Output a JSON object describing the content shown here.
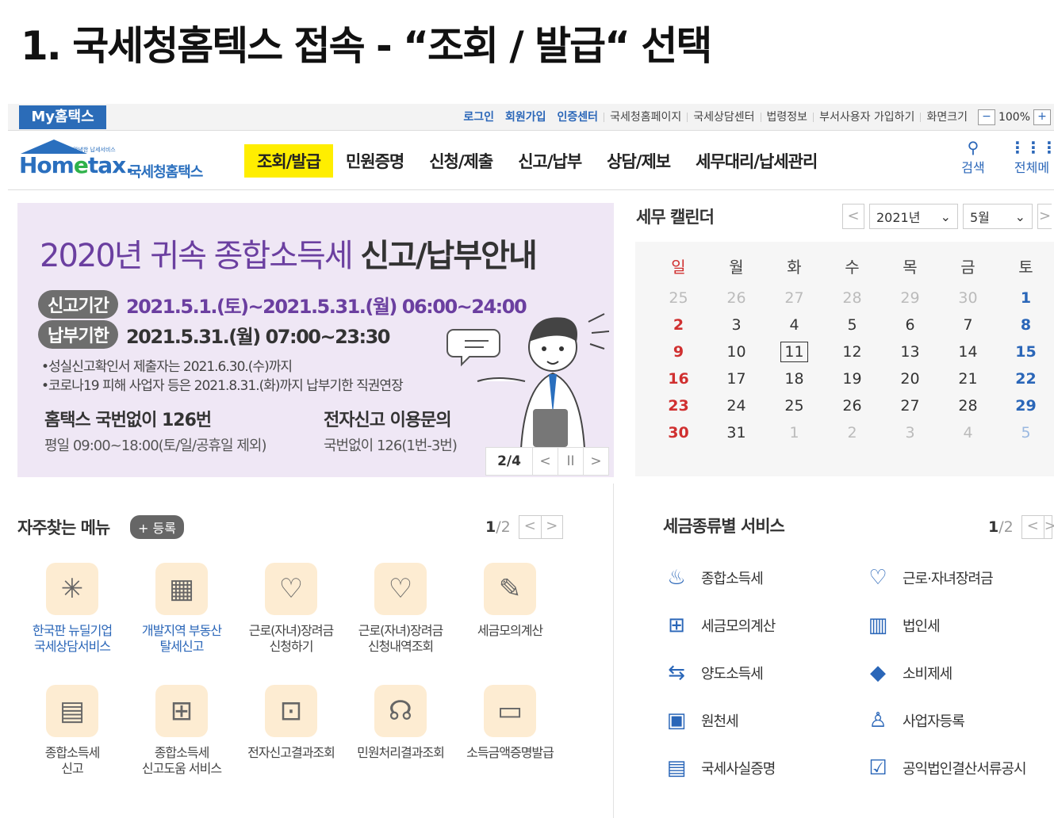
{
  "slide_title": "1. 국세청홈텍스 접속 - “조회 / 발급“ 선택",
  "util": {
    "my_hometax": "My홈택스",
    "primary_links": [
      "로그인",
      "회원가입",
      "인증센터"
    ],
    "links": [
      "국세청홈페이지",
      "국세상담센터",
      "법령정보",
      "부서사용자 가입하기",
      "화면크기"
    ],
    "zoom_minus": "−",
    "zoom_value": "100%",
    "zoom_plus": "+"
  },
  "logo": {
    "sub": "안녕한 납세서비스",
    "main_a": "Hom",
    "main_b": "e",
    "main_c": "tax.",
    "kr": "국세청홈택스"
  },
  "menu": [
    "조회/발급",
    "민원증명",
    "신청/제출",
    "신고/납부",
    "상담/제보",
    "세무대리/납세관리"
  ],
  "nav_right": {
    "search_label": "검색",
    "all_label": "전체메"
  },
  "banner": {
    "title_a": "2020년 귀속 종합소득세 ",
    "title_b": "신고/납부안내",
    "pill1": "신고기간",
    "date1": "2021.5.1.(토)~2021.5.31.(월) 06:00~24:00",
    "pill2": "납부기한",
    "date2": "2021.5.31.(월) 07:00~23:30",
    "note1": "•성실신고확인서 제출자는 2021.6.30.(수)까지",
    "note2": "•코로나19 피해 사업자 등은 2021.8.31.(화)까지 납부기한 직권연장",
    "contact1_h": "홈택스 국번없이 126번",
    "contact1_s": "평일 09:00~18:00(토/일/공휴일 제외)",
    "contact2_h": "전자신고 이용문의",
    "contact2_s": "국번없이 126(1번-3번)",
    "page": "2/4",
    "prev": "<",
    "pause": "II",
    "next": ">"
  },
  "calendar": {
    "title": "세무 캘린더",
    "year": "2021년",
    "month": "5월",
    "prev": "<",
    "next": ">",
    "dow": [
      "일",
      "월",
      "화",
      "수",
      "목",
      "금",
      "토"
    ],
    "weeks": [
      [
        "25",
        "26",
        "27",
        "28",
        "29",
        "30",
        "1"
      ],
      [
        "2",
        "3",
        "4",
        "5",
        "6",
        "7",
        "8"
      ],
      [
        "9",
        "10",
        "11",
        "12",
        "13",
        "14",
        "15"
      ],
      [
        "16",
        "17",
        "18",
        "19",
        "20",
        "21",
        "22"
      ],
      [
        "23",
        "24",
        "25",
        "26",
        "27",
        "28",
        "29"
      ],
      [
        "30",
        "31",
        "1",
        "2",
        "3",
        "4",
        "5"
      ]
    ]
  },
  "frequent": {
    "title": "자주찾는 메뉴",
    "register": "+ 등록",
    "page_cur": "1",
    "page_total": "/2",
    "items": [
      {
        "label1": "한국판 뉴딜기업",
        "label2": "국세상담서비스",
        "icon": "sparkle-icon",
        "glyph": "✳"
      },
      {
        "label1": "개발지역 부동산",
        "label2": "탈세신고",
        "icon": "building-report-icon",
        "glyph": "▦"
      },
      {
        "label1": "근로(자녀)장려금",
        "label2": "신청하기",
        "icon": "heart-pen-icon",
        "glyph": "♡"
      },
      {
        "label1": "근로(자녀)장려금",
        "label2": "신청내역조회",
        "icon": "heart-search-icon",
        "glyph": "♡"
      },
      {
        "label1": "세금모의계산",
        "label2": "",
        "icon": "calculator-pen-icon",
        "glyph": "✎"
      },
      {
        "label1": "종합소득세",
        "label2": "신고",
        "icon": "calendar-pen-icon",
        "glyph": "▤"
      },
      {
        "label1": "종합소득세",
        "label2": "신고도움 서비스",
        "icon": "document-search-icon",
        "glyph": "⊞"
      },
      {
        "label1": "전자신고결과조회",
        "label2": "",
        "icon": "result-search-icon",
        "glyph": "⊡"
      },
      {
        "label1": "민원처리결과조회",
        "label2": "",
        "icon": "headset-icon",
        "glyph": "☊"
      },
      {
        "label1": "소득금액증명발급",
        "label2": "",
        "icon": "printer-icon",
        "glyph": "▭"
      }
    ]
  },
  "taxes": {
    "title": "세금종류별 서비스",
    "page_cur": "1",
    "page_total": "/2",
    "items": [
      {
        "label": "종합소득세",
        "icon": "money-bag-icon",
        "glyph": "♨"
      },
      {
        "label": "근로·자녀장려금",
        "icon": "heart-icon",
        "glyph": "♡"
      },
      {
        "label": "세금모의계산",
        "icon": "calculator-icon",
        "glyph": "⊞"
      },
      {
        "label": "법인세",
        "icon": "office-building-icon",
        "glyph": "▥"
      },
      {
        "label": "양도소득세",
        "icon": "transfer-doc-icon",
        "glyph": "⇆"
      },
      {
        "label": "소비제세",
        "icon": "diamond-icon",
        "glyph": "◆"
      },
      {
        "label": "원천세",
        "icon": "salary-doc-icon",
        "glyph": "▣"
      },
      {
        "label": "사업자등록",
        "icon": "person-icon",
        "glyph": "♙"
      },
      {
        "label": "국세사실증명",
        "icon": "document-icon",
        "glyph": "▤"
      },
      {
        "label": "공익법인결산서류공시",
        "icon": "clipboard-check-icon",
        "glyph": "☑"
      }
    ]
  }
}
